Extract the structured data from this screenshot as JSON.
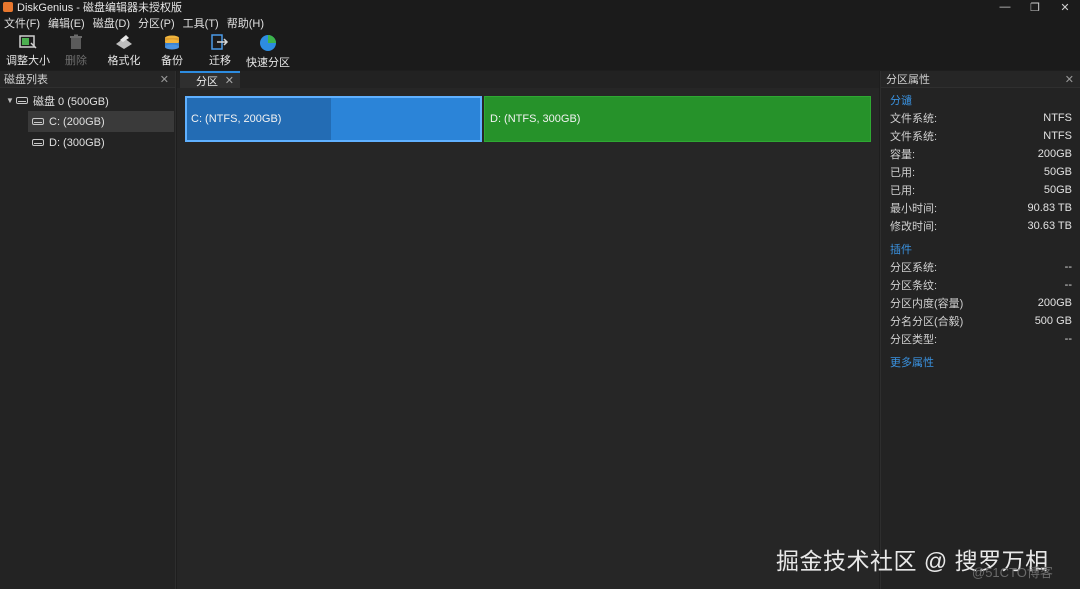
{
  "window": {
    "title": "DiskGenius - 磁盘编辑器未授权版",
    "controls": {
      "minimize": "—",
      "maximize": "❐",
      "close": "✕"
    }
  },
  "menu": [
    "文件(F)",
    "编辑(E)",
    "磁盘(D)",
    "分区(P)",
    "工具(T)",
    "帮助(H)"
  ],
  "toolbar": {
    "resize": "调整大小",
    "delete": "删除",
    "format": "格式化",
    "backup": "备份",
    "migrate": "迁移",
    "quick_partition": "快速分区"
  },
  "disk_list": {
    "title": "磁盘列表",
    "close": "✕",
    "disk": "磁盘 0 (500GB)",
    "partitions": [
      "C: (200GB)",
      "D: (300GB)"
    ]
  },
  "tab": {
    "label": "分区",
    "close": "✕"
  },
  "partition_map": {
    "c_label": "C: (NTFS, 200GB)",
    "c_used_fraction": 0.49,
    "d_label": "D: (NTFS, 300GB)",
    "c_color": "#2b84d8",
    "d_color": "#26922a"
  },
  "properties": {
    "title": "分区属性",
    "close": "✕",
    "section1_title": "分谴",
    "section1": [
      {
        "k": "文件系统:",
        "v": "NTFS"
      },
      {
        "k": "文件系统:",
        "v": "NTFS"
      },
      {
        "k": "容量:",
        "v": "200GB"
      },
      {
        "k": "已用:",
        "v": "50GB"
      },
      {
        "k": "已用:",
        "v": "50GB"
      },
      {
        "k": "最小时间:",
        "v": "90.83 TB"
      },
      {
        "k": "修改时间:",
        "v": "30.63 TB"
      }
    ],
    "section2_title": "插件",
    "section2": [
      {
        "k": "分区系统:",
        "v": "--"
      },
      {
        "k": "分区条纹:",
        "v": "--"
      },
      {
        "k": "分区内度(容量)",
        "v": "200GB"
      },
      {
        "k": "分名分区(合毅)",
        "v": "500 GB"
      },
      {
        "k": "分区类型:",
        "v": "--"
      }
    ],
    "more": "更多属性"
  },
  "watermark": {
    "main": "掘金技术社区 @ 搜罗万相",
    "sub": "@51CTO博客"
  }
}
